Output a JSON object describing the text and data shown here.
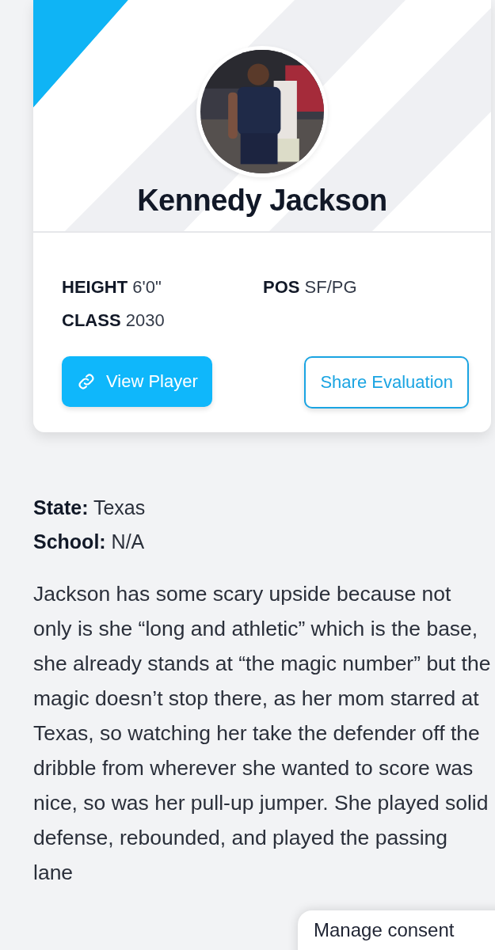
{
  "player": {
    "name": "Kennedy Jackson",
    "stats": [
      {
        "label": "HEIGHT",
        "value": "6'0\""
      },
      {
        "label": "POS",
        "value": "SF/PG"
      },
      {
        "label": "CLASS",
        "value": "2030"
      }
    ],
    "buttons": [
      {
        "label": "View Player",
        "kind": "primary"
      },
      {
        "label": "Share Evaluation",
        "kind": "outline"
      }
    ]
  },
  "details": [
    {
      "label": "State:",
      "value": "Texas"
    },
    {
      "label": "School:",
      "value": "N/A"
    }
  ],
  "evaluation": "Jackson has some scary upside because not only is she “long and athletic” which is the base, she already stands at “the magic number” but the magic doesn’t stop there, as her mom starred at Texas, so watching her take the defender off the dribble from wherever she wanted to score was nice, so was her pull-up jumper. She played solid defense, rebounded, and played the passing lane",
  "consent_button": "Manage consent"
}
